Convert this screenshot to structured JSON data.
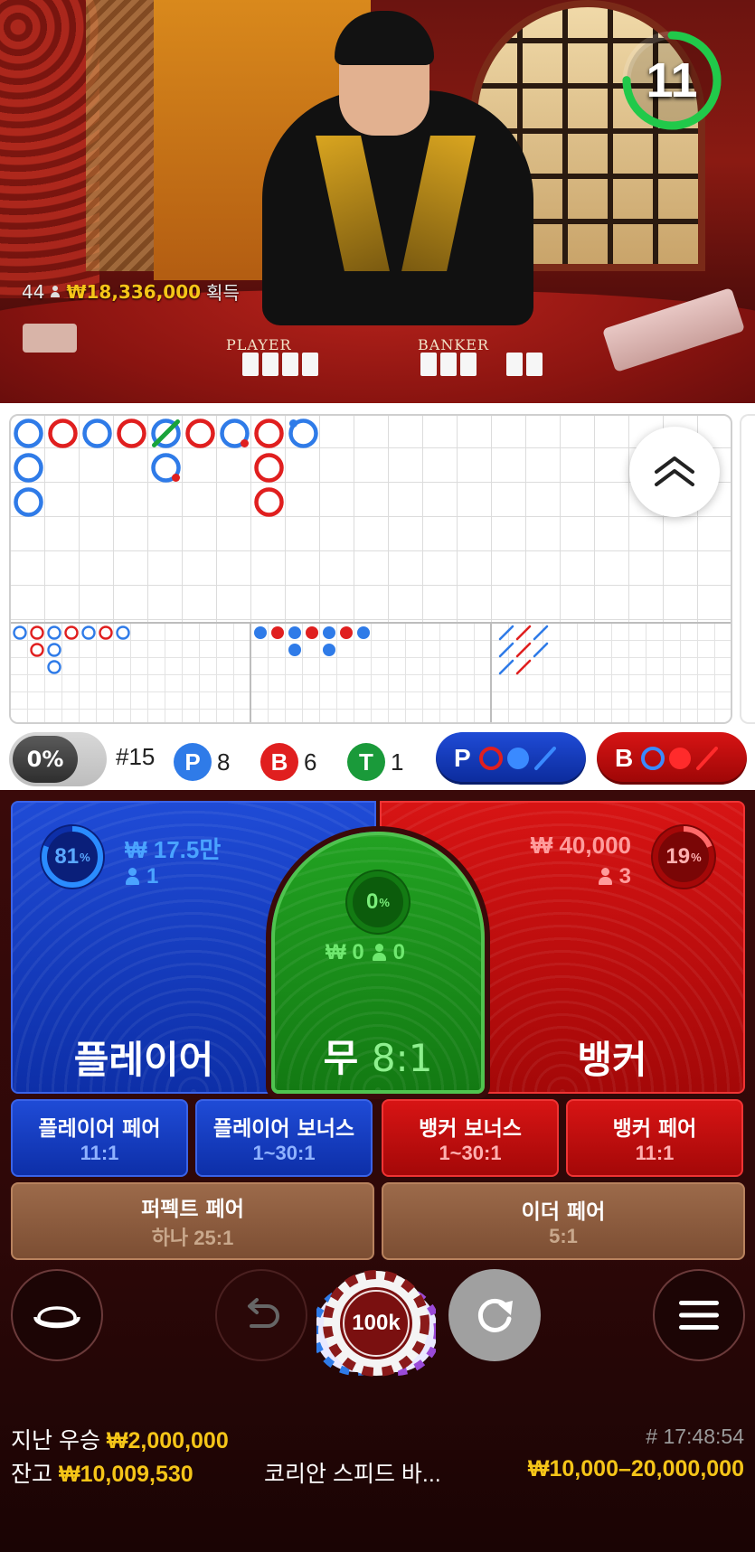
{
  "video": {
    "table_labels": {
      "player": "PLAYER",
      "banker": "BANKER"
    },
    "winners": {
      "count": "44",
      "amount": "₩18,336,000",
      "suffix": "획득"
    },
    "timer": {
      "seconds": "11",
      "remaining_fraction": 0.75,
      "color": "#21c94a"
    }
  },
  "roadmap": {
    "big_road": [
      {
        "col": 0,
        "row": 0,
        "type": "P"
      },
      {
        "col": 0,
        "row": 1,
        "type": "P"
      },
      {
        "col": 0,
        "row": 2,
        "type": "P"
      },
      {
        "col": 1,
        "row": 0,
        "type": "B"
      },
      {
        "col": 2,
        "row": 0,
        "type": "P"
      },
      {
        "col": 3,
        "row": 0,
        "type": "B"
      },
      {
        "col": 4,
        "row": 0,
        "type": "P",
        "tie": true
      },
      {
        "col": 4,
        "row": 1,
        "type": "P",
        "bdot": true
      },
      {
        "col": 5,
        "row": 0,
        "type": "B"
      },
      {
        "col": 6,
        "row": 0,
        "type": "P",
        "bdot": true
      },
      {
        "col": 7,
        "row": 0,
        "type": "B"
      },
      {
        "col": 7,
        "row": 1,
        "type": "B"
      },
      {
        "col": 7,
        "row": 2,
        "type": "B"
      },
      {
        "col": 8,
        "row": 0,
        "type": "P",
        "pdot": true
      }
    ],
    "big_eye_boy": [
      {
        "col": 0,
        "row": 0,
        "type": "P"
      },
      {
        "col": 1,
        "row": 0,
        "type": "B"
      },
      {
        "col": 1,
        "row": 1,
        "type": "B"
      },
      {
        "col": 2,
        "row": 0,
        "type": "P"
      },
      {
        "col": 2,
        "row": 1,
        "type": "P"
      },
      {
        "col": 2,
        "row": 2,
        "type": "P"
      },
      {
        "col": 3,
        "row": 0,
        "type": "B"
      },
      {
        "col": 4,
        "row": 0,
        "type": "P"
      },
      {
        "col": 5,
        "row": 0,
        "type": "B"
      },
      {
        "col": 6,
        "row": 0,
        "type": "P"
      }
    ],
    "small_road": [
      {
        "col": 0,
        "row": 0,
        "type": "P"
      },
      {
        "col": 1,
        "row": 0,
        "type": "B"
      },
      {
        "col": 2,
        "row": 0,
        "type": "P"
      },
      {
        "col": 2,
        "row": 1,
        "type": "P"
      },
      {
        "col": 3,
        "row": 0,
        "type": "B"
      },
      {
        "col": 4,
        "row": 0,
        "type": "P"
      },
      {
        "col": 4,
        "row": 1,
        "type": "P"
      },
      {
        "col": 5,
        "row": 0,
        "type": "B"
      },
      {
        "col": 6,
        "row": 0,
        "type": "P"
      }
    ],
    "cockroach_road": [
      {
        "col": 0,
        "row": 0,
        "type": "P"
      },
      {
        "col": 1,
        "row": 0,
        "type": "B"
      },
      {
        "col": 2,
        "row": 0,
        "type": "P"
      },
      {
        "col": 0,
        "row": 1,
        "type": "P"
      },
      {
        "col": 1,
        "row": 1,
        "type": "B"
      },
      {
        "col": 2,
        "row": 1,
        "type": "P"
      },
      {
        "col": 0,
        "row": 2,
        "type": "P"
      },
      {
        "col": 1,
        "row": 2,
        "type": "B"
      }
    ],
    "colors": {
      "player": "#2f7be8",
      "banker": "#e01f1f",
      "tie": "#1aa33a"
    }
  },
  "stats": {
    "percent_toggle": "0%",
    "round": "#15",
    "player": {
      "letter": "P",
      "count": "8",
      "color": "#2f7be8"
    },
    "banker": {
      "letter": "B",
      "count": "6",
      "color": "#e01f1f"
    },
    "tie": {
      "letter": "T",
      "count": "1",
      "color": "#1a9a3a"
    },
    "player_predict": "P",
    "banker_predict": "B"
  },
  "bets": {
    "player": {
      "label": "플레이어",
      "amount": "₩ 17.5만",
      "users": "1",
      "percent": "81",
      "percent_value": 0.81,
      "pct_sign": "%"
    },
    "tie": {
      "label": "무",
      "odds": "8:1",
      "amount": "₩ 0",
      "users": "0",
      "percent": "0",
      "percent_value": 0.0,
      "pct_sign": "%"
    },
    "banker": {
      "label": "뱅커",
      "amount": "₩ 40,000",
      "users": "3",
      "percent": "19",
      "percent_value": 0.19,
      "pct_sign": "%"
    },
    "side": [
      {
        "title": "플레이어 페어",
        "odds": "11:1",
        "color": "blue"
      },
      {
        "title": "플레이어 보너스",
        "odds": "1~30:1",
        "color": "blue"
      },
      {
        "title": "뱅커 보너스",
        "odds": "1~30:1",
        "color": "red"
      },
      {
        "title": "뱅커 페어",
        "odds": "11:1",
        "color": "red"
      }
    ],
    "pairs": [
      {
        "title": "퍼펙트 페어",
        "odds": "하나 25:1"
      },
      {
        "title": "이더 페어",
        "odds": "5:1"
      }
    ]
  },
  "controls": {
    "chip_value": "100k"
  },
  "footer": {
    "last_win_label": "지난 우승",
    "last_win_amount": "₩2,000,000",
    "round_time": "# 17:48:54",
    "balance_label": "잔고",
    "balance_amount": "₩10,009,530",
    "table_name": "코리안 스피드 바...",
    "limits": "₩10,000–20,000,000"
  }
}
